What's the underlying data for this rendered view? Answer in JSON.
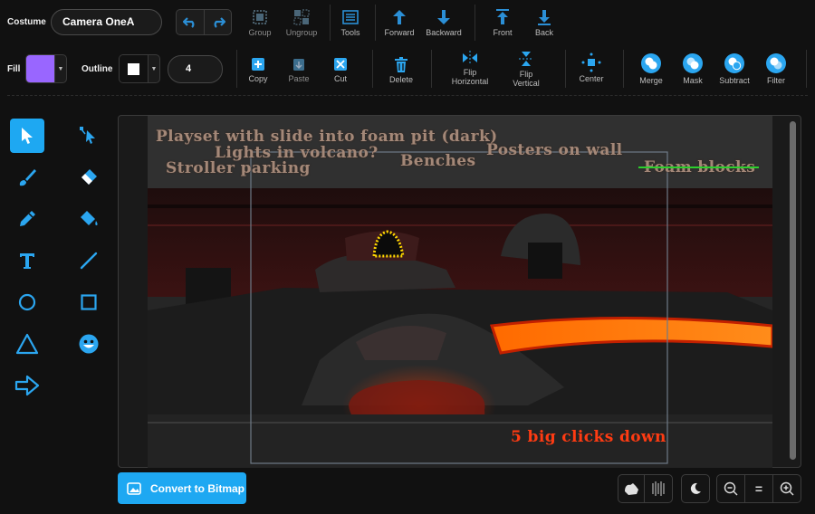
{
  "costume": {
    "label": "Costume",
    "name": "Camera OneA"
  },
  "toolbar": {
    "group": "Group",
    "ungroup": "Ungroup",
    "tools": "Tools",
    "forward": "Forward",
    "backward": "Backward",
    "front": "Front",
    "back": "Back"
  },
  "style": {
    "fill_label": "Fill",
    "fill_color": "#9966ff",
    "outline_label": "Outline",
    "outline_color": "#ffffff",
    "outline_width": "4"
  },
  "edit": {
    "copy": "Copy",
    "paste": "Paste",
    "cut": "Cut",
    "delete": "Delete",
    "flip_h_1": "Flip",
    "flip_h_2": "Horizontal",
    "flip_v_1": "Flip",
    "flip_v_2": "Vertical",
    "center": "Center",
    "merge": "Merge",
    "mask": "Mask",
    "subtract": "Subtract",
    "filter": "Filter"
  },
  "tools": [
    "select",
    "reshape",
    "brush",
    "eraser",
    "pen",
    "fill",
    "text",
    "line",
    "circle",
    "rectangle",
    "triangle",
    "emoji",
    "arrow"
  ],
  "canvas": {
    "notes": {
      "playset": "Playset with slide into foam pit (dark)",
      "volcano": "Lights in volcano?",
      "posters": "Posters on wall",
      "stroller": "Stroller parking",
      "benches": "Benches",
      "foam": "Foam blocks",
      "clicks": "5 big clicks down"
    }
  },
  "bottom": {
    "convert": "Convert to Bitmap",
    "zoom_reset": "="
  },
  "colors": {
    "accent": "#1ea8f2",
    "note_tan": "#a48878",
    "note_red": "#ff3b12",
    "strike": "#2ccf2c"
  }
}
